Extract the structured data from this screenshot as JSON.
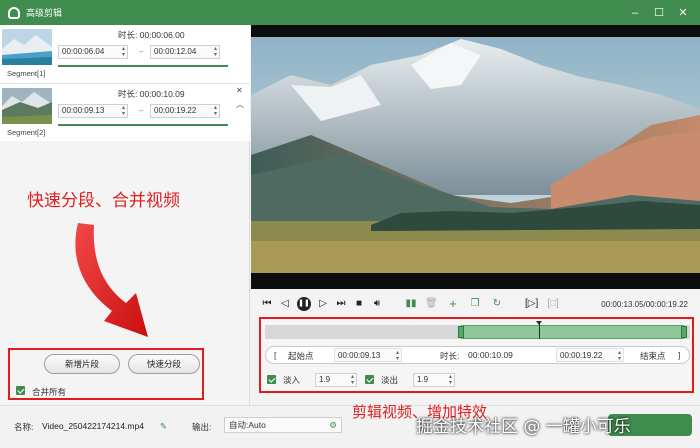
{
  "window": {
    "title": "高级剪辑",
    "controls": [
      "–",
      "☐",
      "✕"
    ]
  },
  "segments": [
    {
      "label": "Segment[1]",
      "duration": "时长: 00:00:06.00",
      "start": "00:00:06.04",
      "end": "00:00:12.04"
    },
    {
      "label": "Segment[2]",
      "duration": "时长: 00:00:10.09",
      "start": "00:00:09.13",
      "end": "00:00:19.22"
    }
  ],
  "annotations": {
    "left": "快速分段、合并视频",
    "bottom": "剪辑视频、增加特效"
  },
  "buttons": {
    "add_segment": "新增片段",
    "quick_split": "快速分段",
    "merge_all": "合并所有"
  },
  "player": {
    "timecode": "00:00:13.05/00:00:19.22"
  },
  "timeline": {
    "selection_start_fraction": 0.46,
    "selection_end_fraction": 0.985,
    "cursor_fraction": 0.645
  },
  "range": {
    "start_bracket": "[",
    "start_label": "起始点",
    "start_value": "00:00:09.13",
    "duration_label": "时长:",
    "duration_value": "00:00:10.09",
    "end_value": "00:00:19.22",
    "end_label": "结束点",
    "end_bracket": "]"
  },
  "effects": {
    "fade_in_label": "淡入",
    "fade_in_value": "1.9",
    "fade_out_label": "淡出",
    "fade_out_value": "1.9"
  },
  "bottom": {
    "name_label": "名称:",
    "name_value": "Video_250422174214.mp4",
    "output_label": "输出:",
    "output_value": "自动:Auto"
  },
  "watermark": "掘金技术社区 @ 一罐小可乐",
  "colors": {
    "accent": "#3f8c4e",
    "annotation": "#e02020"
  }
}
